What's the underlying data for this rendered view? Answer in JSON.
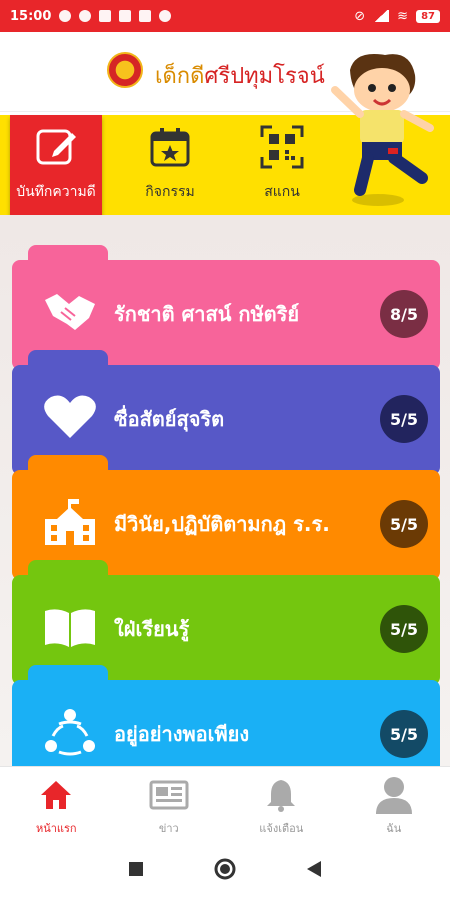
{
  "status_bar": {
    "time": "15:00",
    "battery": "87"
  },
  "header": {
    "title_part1": "เด็กดี",
    "title_part2": "ศรีปทุมโรจน์"
  },
  "top_menu": [
    {
      "label": "บันทึกความดี",
      "icon": "edit-icon",
      "active": true
    },
    {
      "label": "กิจกรรม",
      "icon": "calendar-star-icon",
      "active": false
    },
    {
      "label": "สแกน",
      "icon": "qr-scan-icon",
      "active": false
    }
  ],
  "categories": [
    {
      "label": "รักชาติ ศาสน์ กษัตริย์",
      "score": "8/5",
      "color": "#f7649a",
      "badge": "#7a2e44",
      "icon": "handshake-icon"
    },
    {
      "label": "ซื่อสัตย์สุจริต",
      "score": "5/5",
      "color": "#5758c7",
      "badge": "#22245e",
      "icon": "heart-icon"
    },
    {
      "label": "มีวินัย,ปฏิบัติตามกฎ ร.ร.",
      "score": "5/5",
      "color": "#ff8a00",
      "badge": "#6b3a05",
      "icon": "school-icon"
    },
    {
      "label": "ใฝ่เรียนรู้",
      "score": "5/5",
      "color": "#74c60f",
      "badge": "#2f5409",
      "icon": "book-icon"
    },
    {
      "label": "อยู่อย่างพอเพียง",
      "score": "5/5",
      "color": "#1ab0f5",
      "badge": "#134a66",
      "icon": "people-cycle-icon"
    }
  ],
  "bottom_nav": [
    {
      "label": "หน้าแรก",
      "icon": "home-icon",
      "active": true
    },
    {
      "label": "ข่าว",
      "icon": "news-icon",
      "active": false
    },
    {
      "label": "แจ้งเตือน",
      "icon": "bell-icon",
      "active": false
    },
    {
      "label": "ฉัน",
      "icon": "user-icon",
      "active": false
    }
  ],
  "colors": {
    "accent": "#e8262a",
    "menu_band": "#ffe000"
  }
}
